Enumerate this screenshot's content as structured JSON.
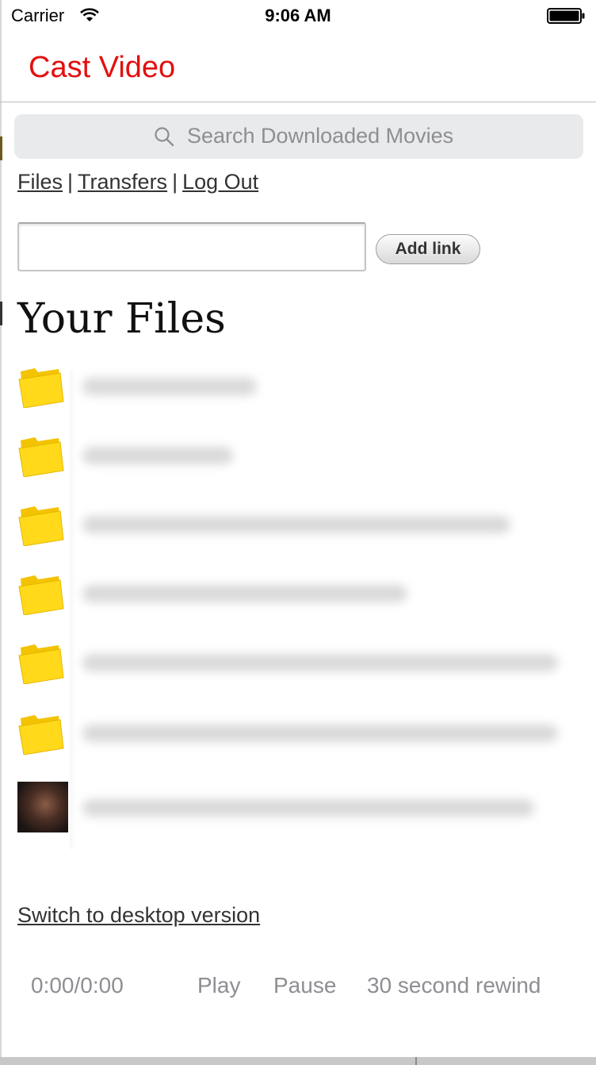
{
  "status_bar": {
    "carrier": "Carrier",
    "time": "9:06 AM"
  },
  "nav": {
    "title": "Cast Video",
    "title_color": "#e30f0f"
  },
  "search": {
    "placeholder": "Search Downloaded Movies",
    "icon": "search-icon"
  },
  "links": {
    "files": "Files",
    "transfers": "Transfers",
    "logout": "Log Out",
    "separator": "|"
  },
  "add_link": {
    "input_value": "",
    "button_label": "Add link"
  },
  "heading": "Your Files",
  "files": [
    {
      "type": "folder",
      "icon": "folder-icon",
      "name_obscured": true
    },
    {
      "type": "folder",
      "icon": "folder-icon",
      "name_obscured": true
    },
    {
      "type": "folder",
      "icon": "folder-icon",
      "name_obscured": true
    },
    {
      "type": "folder",
      "icon": "folder-icon",
      "name_obscured": true
    },
    {
      "type": "folder",
      "icon": "folder-icon",
      "name_obscured": true
    },
    {
      "type": "folder",
      "icon": "folder-icon",
      "name_obscured": true
    },
    {
      "type": "video",
      "icon": "video-thumbnail",
      "name_obscured": true
    }
  ],
  "footer": {
    "desktop_link": "Switch to desktop version"
  },
  "player": {
    "time": "0:00/0:00",
    "play": "Play",
    "pause": "Pause",
    "rewind": "30 second rewind"
  }
}
